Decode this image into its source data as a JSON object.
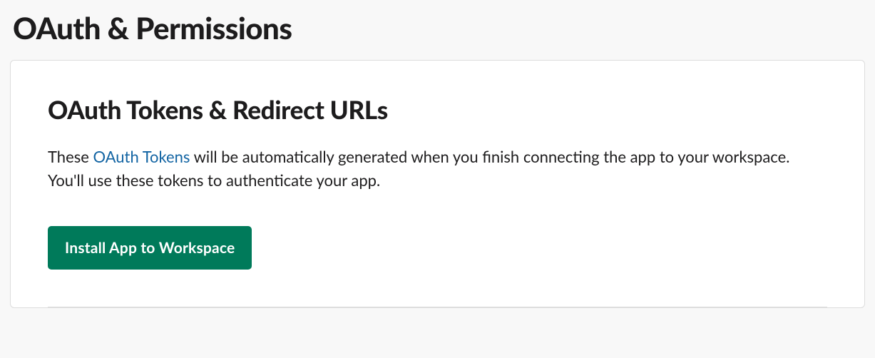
{
  "page": {
    "title": "OAuth & Permissions"
  },
  "section": {
    "title": "OAuth Tokens & Redirect URLs",
    "description_prefix": "These ",
    "description_link": "OAuth Tokens",
    "description_suffix": " will be automatically generated when you finish connecting the app to your workspace. You'll use these tokens to authenticate your app.",
    "install_button_label": "Install App to Workspace"
  }
}
